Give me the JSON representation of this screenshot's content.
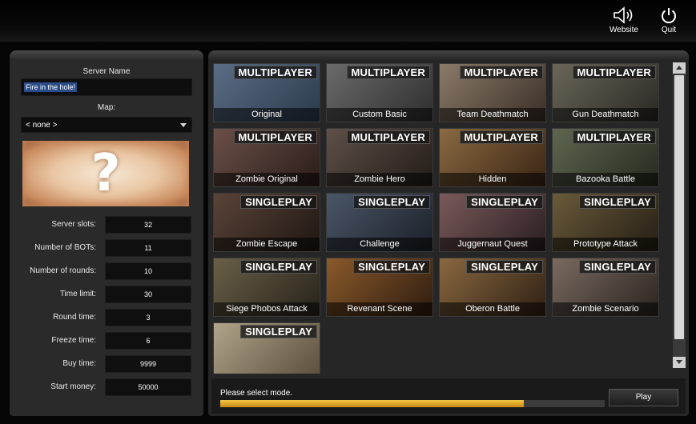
{
  "top": {
    "website_label": "Website",
    "quit_label": "Quit"
  },
  "left": {
    "server_name_label": "Server Name",
    "server_name_value": "Fire in the hole!",
    "map_label": "Map:",
    "map_value": "< none >",
    "map_preview_text": "?",
    "settings": [
      {
        "label": "Server slots:",
        "value": "32"
      },
      {
        "label": "Number of BOTs:",
        "value": "11"
      },
      {
        "label": "Number of rounds:",
        "value": "10"
      },
      {
        "label": "Time limit:",
        "value": "30"
      },
      {
        "label": "Round time:",
        "value": "3"
      },
      {
        "label": "Freeze time:",
        "value": "6"
      },
      {
        "label": "Buy time:",
        "value": "9999"
      },
      {
        "label": "Start money:",
        "value": "50000"
      }
    ]
  },
  "modes": [
    {
      "badge": "MULTIPLAYER",
      "name": "Original",
      "colors": [
        "#5b6d86",
        "#2b3a4c"
      ]
    },
    {
      "badge": "MULTIPLAYER",
      "name": "Custom Basic",
      "colors": [
        "#6b6b6b",
        "#2e2e2e"
      ]
    },
    {
      "badge": "MULTIPLAYER",
      "name": "Team Deathmatch",
      "colors": [
        "#8a7a68",
        "#3a2f28"
      ]
    },
    {
      "badge": "MULTIPLAYER",
      "name": "Gun Deathmatch",
      "colors": [
        "#6a6658",
        "#2a2824"
      ]
    },
    {
      "badge": "MULTIPLAYER",
      "name": "Zombie Original",
      "colors": [
        "#6a5048",
        "#2a1c18"
      ]
    },
    {
      "badge": "MULTIPLAYER",
      "name": "Zombie Hero",
      "colors": [
        "#5e5048",
        "#221c18"
      ]
    },
    {
      "badge": "MULTIPLAYER",
      "name": "Hidden",
      "colors": [
        "#8a6a42",
        "#3a2414"
      ]
    },
    {
      "badge": "MULTIPLAYER",
      "name": "Bazooka Battle",
      "colors": [
        "#5e6650",
        "#262a1e"
      ]
    },
    {
      "badge": "SINGLEPLAY",
      "name": "Zombie Escape",
      "colors": [
        "#5a4438",
        "#1e1612"
      ]
    },
    {
      "badge": "SINGLEPLAY",
      "name": "Challenge",
      "colors": [
        "#4a5668",
        "#1c2028"
      ]
    },
    {
      "badge": "SINGLEPLAY",
      "name": "Juggernaut Quest",
      "colors": [
        "#7a5a5a",
        "#2a1e22"
      ]
    },
    {
      "badge": "SINGLEPLAY",
      "name": "Prototype Attack",
      "colors": [
        "#6a5a3a",
        "#241e14"
      ]
    },
    {
      "badge": "SINGLEPLAY",
      "name": "Siege Phobos Attack",
      "colors": [
        "#6a6048",
        "#26221a"
      ]
    },
    {
      "badge": "SINGLEPLAY",
      "name": "Revenant Scene",
      "colors": [
        "#8a5a2a",
        "#2e1c10"
      ]
    },
    {
      "badge": "SINGLEPLAY",
      "name": "Oberon Battle",
      "colors": [
        "#8a6840",
        "#2e2014"
      ]
    },
    {
      "badge": "SINGLEPLAY",
      "name": "Zombie Scenario",
      "colors": [
        "#7a6a60",
        "#2a2420"
      ]
    },
    {
      "badge": "SINGLEPLAY",
      "name": "",
      "colors": [
        "#b0a48a",
        "#5a4c3a"
      ]
    }
  ],
  "bottom": {
    "status_text": "Please select mode.",
    "progress_fraction": 0.79,
    "play_label": "Play"
  }
}
